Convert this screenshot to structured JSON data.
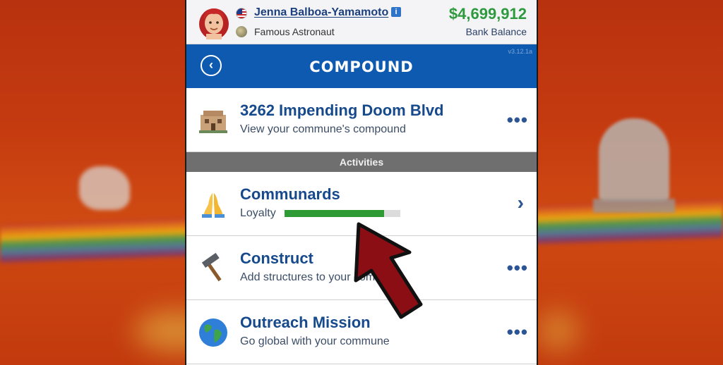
{
  "header": {
    "name": "Jenna Balboa-Yamamoto",
    "info_badge": "i",
    "occupation": "Famous Astronaut",
    "balance": "$4,699,912",
    "balance_label": "Bank Balance"
  },
  "title_bar": {
    "title": "COMPOUND",
    "version": "v3.12.1a",
    "back_glyph": "‹"
  },
  "compound": {
    "address": "3262 Impending Doom Blvd",
    "subtitle": "View your commune's compound",
    "menu": "•••"
  },
  "section_label": "Activities",
  "activities": [
    {
      "title": "Communards",
      "subtitle": "Loyalty",
      "loyalty_fraction": 0.86,
      "action": "›",
      "icon": "praying-hands-icon"
    },
    {
      "title": "Construct",
      "subtitle": "Add structures to your commune",
      "action": "•••",
      "icon": "hammer-icon"
    },
    {
      "title": "Outreach Mission",
      "subtitle": "Go global with your commune",
      "action": "•••",
      "icon": "globe-icon"
    }
  ],
  "colors": {
    "title_bar": "#0e5ab0",
    "balance": "#2e9a3e",
    "loyalty_bar": "#2f9b35",
    "arrow": "#8b0e14"
  }
}
